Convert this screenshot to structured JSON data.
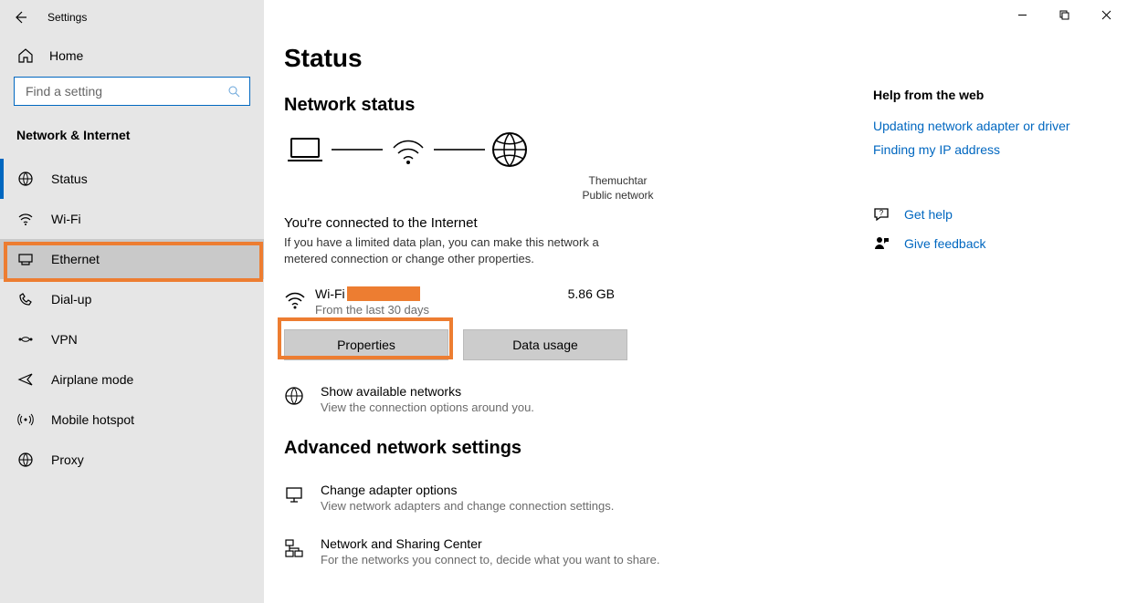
{
  "window": {
    "title": "Settings"
  },
  "sidebar": {
    "home": "Home",
    "search_placeholder": "Find a setting",
    "category": "Network & Internet",
    "items": [
      {
        "label": "Status"
      },
      {
        "label": "Wi-Fi"
      },
      {
        "label": "Ethernet"
      },
      {
        "label": "Dial-up"
      },
      {
        "label": "VPN"
      },
      {
        "label": "Airplane mode"
      },
      {
        "label": "Mobile hotspot"
      },
      {
        "label": "Proxy"
      }
    ]
  },
  "main": {
    "title": "Status",
    "network_status_heading": "Network status",
    "diag": {
      "ssid": "Themuchtar",
      "net_type": "Public network"
    },
    "connected_title": "You're connected to the Internet",
    "connected_desc": "If you have a limited data plan, you can make this network a metered connection or change other properties.",
    "wifi_label": "Wi-Fi ",
    "wifi_sub": "From the last 30 days",
    "data_amount": "5.86 GB",
    "btn_properties": "Properties",
    "btn_data_usage": "Data usage",
    "opt_available_title": "Show available networks",
    "opt_available_desc": "View the connection options around you.",
    "adv_heading": "Advanced network settings",
    "opt_adapter_title": "Change adapter options",
    "opt_adapter_desc": "View network adapters and change connection settings.",
    "opt_sharing_title": "Network and Sharing Center",
    "opt_sharing_desc": "For the networks you connect to, decide what you want to share."
  },
  "right": {
    "help_heading": "Help from the web",
    "links": [
      "Updating network adapter or driver",
      "Finding my IP address"
    ],
    "get_help": "Get help",
    "give_feedback": "Give feedback"
  }
}
